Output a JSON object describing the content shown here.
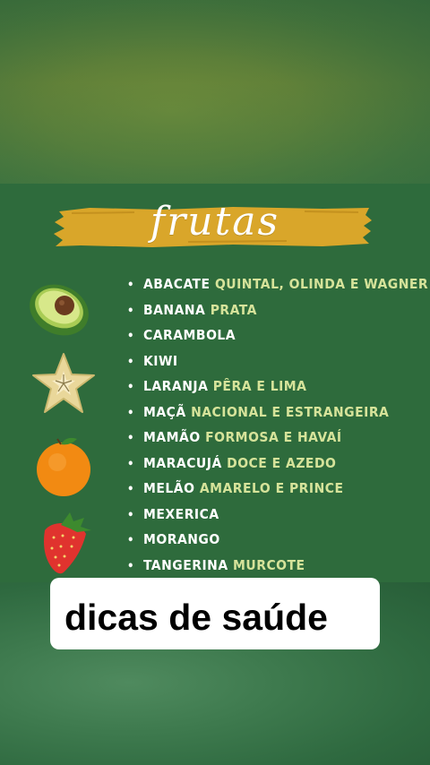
{
  "title": "frutas",
  "caption": "dicas de saúde",
  "colors": {
    "card_green": "#2e6b3c",
    "banner_gold": "#d9a62a",
    "variety_text": "#d6e39a",
    "item_text": "#ffffff"
  },
  "fruit_illustrations": [
    "avocado-icon",
    "star-fruit-icon",
    "orange-icon",
    "strawberry-icon"
  ],
  "items": [
    {
      "name": "ABACATE",
      "variety": "QUINTAL, OLINDA E WAGNER"
    },
    {
      "name": "BANANA",
      "variety": "PRATA"
    },
    {
      "name": "CARAMBOLA",
      "variety": ""
    },
    {
      "name": "KIWI",
      "variety": ""
    },
    {
      "name": "LARANJA",
      "variety": "PÊRA E LIMA"
    },
    {
      "name": "MAÇÃ",
      "variety": "NACIONAL E ESTRANGEIRA"
    },
    {
      "name": "MAMÃO",
      "variety": "FORMOSA E HAVAÍ"
    },
    {
      "name": "MARACUJÁ",
      "variety": "DOCE E AZEDO"
    },
    {
      "name": "MELÃO",
      "variety": "AMARELO E PRINCE"
    },
    {
      "name": "MEXERICA",
      "variety": ""
    },
    {
      "name": "MORANGO",
      "variety": ""
    },
    {
      "name": "TANGERINA",
      "variety": "MURCOTE"
    }
  ]
}
